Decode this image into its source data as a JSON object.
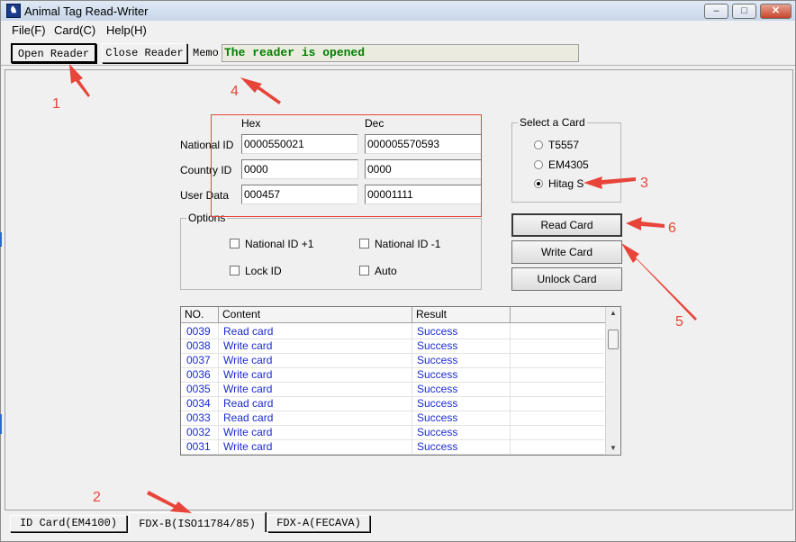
{
  "window": {
    "title": "Animal Tag Read-Writer",
    "minimize": "–",
    "maximize": "□",
    "close": "✕"
  },
  "menu": [
    "File(F)",
    "Card(C)",
    "Help(H)"
  ],
  "toolbar": {
    "open_reader": "Open Reader",
    "close_reader": "Close Reader",
    "memo_label": "Memo",
    "memo_value": "The reader is opened"
  },
  "ids": {
    "hex_header": "Hex",
    "dec_header": "Dec",
    "rows": [
      {
        "label": "National ID",
        "hex": "0000550021",
        "dec": "000005570593"
      },
      {
        "label": "Country ID",
        "hex": "0000",
        "dec": "0000"
      },
      {
        "label": "User Data",
        "hex": "000457",
        "dec": "00001111"
      }
    ]
  },
  "card_select": {
    "title": "Select a Card",
    "options": [
      "T5557",
      "EM4305",
      "Hitag S"
    ],
    "selected": "Hitag S"
  },
  "options": {
    "title": "Options",
    "items": [
      {
        "label": "National ID +1",
        "checked": false
      },
      {
        "label": "National ID -1",
        "checked": false
      },
      {
        "label": "Lock ID",
        "checked": false
      },
      {
        "label": "Auto",
        "checked": false
      }
    ]
  },
  "actions": {
    "read": "Read Card",
    "write": "Write Card",
    "unlock": "Unlock Card"
  },
  "log": {
    "headers": [
      "NO.",
      "Content",
      "Result"
    ],
    "rows": [
      [
        "0039",
        "Read card",
        "Success"
      ],
      [
        "0038",
        "Write card",
        "Success"
      ],
      [
        "0037",
        "Write card",
        "Success"
      ],
      [
        "0036",
        "Write card",
        "Success"
      ],
      [
        "0035",
        "Write card",
        "Success"
      ],
      [
        "0034",
        "Read card",
        "Success"
      ],
      [
        "0033",
        "Read card",
        "Success"
      ],
      [
        "0032",
        "Write card",
        "Success"
      ],
      [
        "0031",
        "Write card",
        "Success"
      ]
    ]
  },
  "tabs": [
    "ID Card(EM4100)",
    "FDX-B(ISO11784/85)",
    "FDX-A(FECAVA)"
  ],
  "active_tab": "FDX-B(ISO11784/85)",
  "annotations": [
    "1",
    "2",
    "3",
    "4",
    "5",
    "6"
  ],
  "colors": {
    "annotation": "#e8453a",
    "memo_text": "#008000",
    "log_text": "#1a2ad0"
  }
}
